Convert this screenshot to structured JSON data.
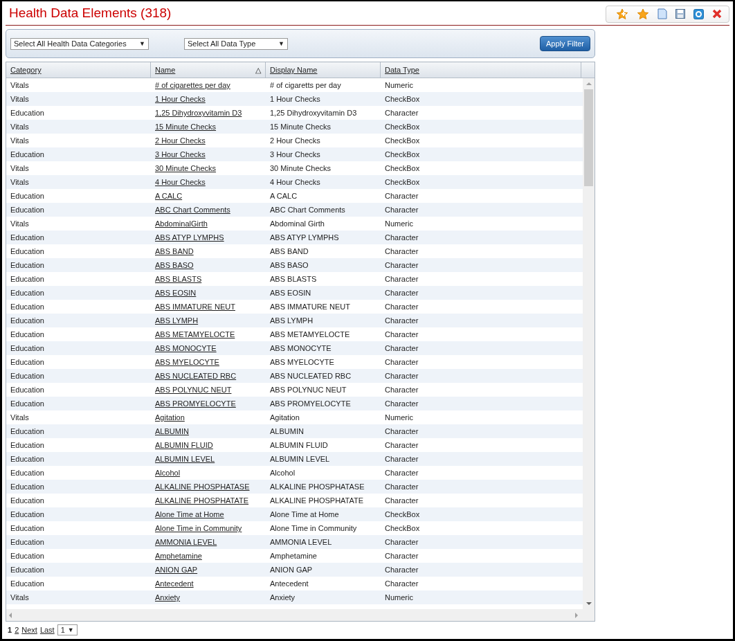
{
  "page": {
    "title": "Health Data Elements (318)"
  },
  "toolbar": {
    "buttons": [
      {
        "kind": "add-favorite"
      },
      {
        "kind": "favorite"
      },
      {
        "kind": "page"
      },
      {
        "kind": "save"
      },
      {
        "kind": "settings"
      },
      {
        "kind": "close"
      }
    ]
  },
  "filters": {
    "dropdowns": [
      {
        "value": "Select All Health Data Categories"
      },
      {
        "value": "Select All Data Type"
      }
    ],
    "apply_button": "Apply Filter"
  },
  "table": {
    "columns": [
      {
        "label": "Category"
      },
      {
        "label": "Name",
        "sort_indicator": "△"
      },
      {
        "label": "Display Name"
      },
      {
        "label": "Data Type"
      }
    ],
    "rows": [
      {
        "category": "Vitals",
        "name": "# of cigarettes per day",
        "display_name": "# of cigaretts per day",
        "data_type": "Numeric"
      },
      {
        "category": "Vitals",
        "name": "1 Hour Checks",
        "display_name": "1 Hour Checks",
        "data_type": "CheckBox"
      },
      {
        "category": "Education",
        "name": "1,25 Dihydroxyvitamin D3",
        "display_name": "1,25 Dihydroxyvitamin D3",
        "data_type": "Character"
      },
      {
        "category": "Vitals",
        "name": "15 Minute Checks",
        "display_name": "15 Minute Checks",
        "data_type": "CheckBox"
      },
      {
        "category": "Vitals",
        "name": "2 Hour Checks",
        "display_name": "2 Hour Checks",
        "data_type": "CheckBox"
      },
      {
        "category": "Education",
        "name": "3 Hour Checks",
        "display_name": "3 Hour Checks",
        "data_type": "CheckBox"
      },
      {
        "category": "Vitals",
        "name": "30 Minute Checks",
        "display_name": "30 Minute Checks",
        "data_type": "CheckBox"
      },
      {
        "category": "Vitals",
        "name": "4 Hour Checks",
        "display_name": "4 Hour Checks",
        "data_type": "CheckBox"
      },
      {
        "category": "Education",
        "name": "A CALC",
        "display_name": "A CALC",
        "data_type": "Character"
      },
      {
        "category": "Education",
        "name": "ABC Chart Comments",
        "display_name": "ABC Chart Comments",
        "data_type": "Character"
      },
      {
        "category": "Vitals",
        "name": "AbdominalGirth",
        "display_name": "Abdominal Girth",
        "data_type": "Numeric"
      },
      {
        "category": "Education",
        "name": "ABS ATYP LYMPHS",
        "display_name": "ABS ATYP LYMPHS",
        "data_type": "Character"
      },
      {
        "category": "Education",
        "name": "ABS BAND",
        "display_name": "ABS BAND",
        "data_type": "Character"
      },
      {
        "category": "Education",
        "name": "ABS BASO",
        "display_name": "ABS BASO",
        "data_type": "Character"
      },
      {
        "category": "Education",
        "name": "ABS BLASTS",
        "display_name": "ABS BLASTS",
        "data_type": "Character"
      },
      {
        "category": "Education",
        "name": "ABS EOSIN",
        "display_name": "ABS EOSIN",
        "data_type": "Character"
      },
      {
        "category": "Education",
        "name": "ABS IMMATURE NEUT",
        "display_name": "ABS IMMATURE NEUT",
        "data_type": "Character"
      },
      {
        "category": "Education",
        "name": "ABS LYMPH",
        "display_name": "ABS LYMPH",
        "data_type": "Character"
      },
      {
        "category": "Education",
        "name": "ABS METAMYELOCTE",
        "display_name": "ABS METAMYELOCTE",
        "data_type": "Character"
      },
      {
        "category": "Education",
        "name": "ABS MONOCYTE",
        "display_name": "ABS MONOCYTE",
        "data_type": "Character"
      },
      {
        "category": "Education",
        "name": "ABS MYELOCYTE",
        "display_name": "ABS MYELOCYTE",
        "data_type": "Character"
      },
      {
        "category": "Education",
        "name": "ABS NUCLEATED RBC",
        "display_name": "ABS NUCLEATED RBC",
        "data_type": "Character"
      },
      {
        "category": "Education",
        "name": "ABS POLYNUC NEUT",
        "display_name": "ABS POLYNUC NEUT",
        "data_type": "Character"
      },
      {
        "category": "Education",
        "name": "ABS PROMYELOCYTE",
        "display_name": "ABS PROMYELOCYTE",
        "data_type": "Character"
      },
      {
        "category": "Vitals",
        "name": "Agitation",
        "display_name": "Agitation",
        "data_type": "Numeric"
      },
      {
        "category": "Education",
        "name": "ALBUMIN",
        "display_name": "ALBUMIN",
        "data_type": "Character"
      },
      {
        "category": "Education",
        "name": "ALBUMIN FLUID",
        "display_name": "ALBUMIN FLUID",
        "data_type": "Character"
      },
      {
        "category": "Education",
        "name": "ALBUMIN LEVEL",
        "display_name": "ALBUMIN LEVEL",
        "data_type": "Character"
      },
      {
        "category": "Education",
        "name": "Alcohol",
        "display_name": "Alcohol",
        "data_type": "Character"
      },
      {
        "category": "Education",
        "name": "ALKALINE PHOSPHATASE",
        "display_name": "ALKALINE PHOSPHATASE",
        "data_type": "Character"
      },
      {
        "category": "Education",
        "name": "ALKALINE PHOSPHATATE",
        "display_name": "ALKALINE PHOSPHATATE",
        "data_type": "Character"
      },
      {
        "category": "Education",
        "name": "Alone Time at Home",
        "display_name": "Alone Time at Home",
        "data_type": "CheckBox"
      },
      {
        "category": "Education",
        "name": "Alone Time in Community",
        "display_name": "Alone Time in Community",
        "data_type": "CheckBox"
      },
      {
        "category": "Education",
        "name": "AMMONIA LEVEL",
        "display_name": "AMMONIA LEVEL",
        "data_type": "Character"
      },
      {
        "category": "Education",
        "name": "Amphetamine",
        "display_name": "Amphetamine",
        "data_type": "Character"
      },
      {
        "category": "Education",
        "name": "ANION GAP",
        "display_name": "ANION GAP",
        "data_type": "Character"
      },
      {
        "category": "Education",
        "name": "Antecedent",
        "display_name": "Antecedent",
        "data_type": "Character"
      },
      {
        "category": "Vitals",
        "name": "Anxiety",
        "display_name": "Anxiety",
        "data_type": "Numeric"
      }
    ]
  },
  "pagination": {
    "pages": [
      {
        "label": "1",
        "selected": true
      },
      {
        "label": "2",
        "selected": false
      }
    ],
    "next": "Next",
    "last": "Last",
    "page_select": {
      "value": "1",
      "arrow": "▼"
    }
  }
}
